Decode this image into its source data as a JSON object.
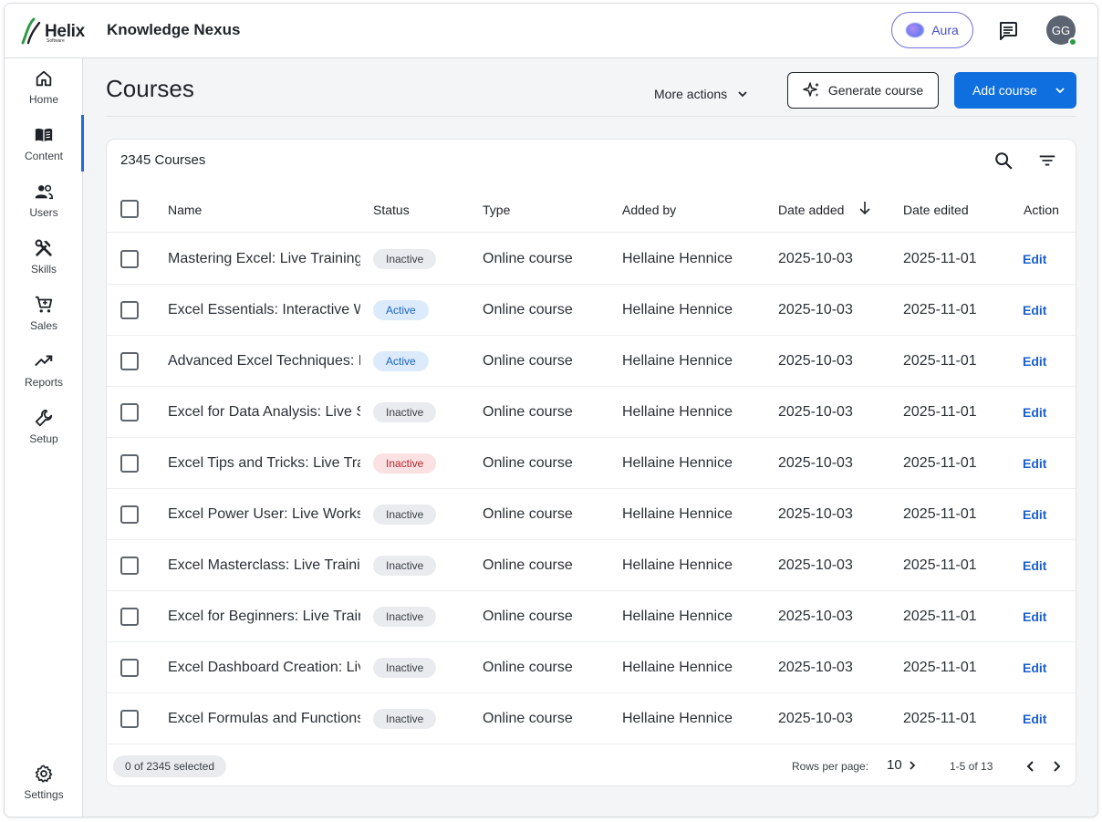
{
  "app": {
    "logo_text": "Helix",
    "logo_sub": "Software",
    "name": "Knowledge Nexus",
    "aura_label": "Aura",
    "avatar_initials": "GG"
  },
  "sidebar": {
    "items": [
      {
        "label": "Home",
        "icon": "home-icon"
      },
      {
        "label": "Content",
        "icon": "book-icon",
        "active": true
      },
      {
        "label": "Users",
        "icon": "users-icon"
      },
      {
        "label": "Skills",
        "icon": "tools-icon"
      },
      {
        "label": "Sales",
        "icon": "cart-icon"
      },
      {
        "label": "Reports",
        "icon": "trending-up-icon"
      },
      {
        "label": "Setup",
        "icon": "wrench-icon"
      }
    ],
    "settings_label": "Settings"
  },
  "page": {
    "title": "Courses",
    "more_actions": "More actions",
    "generate_course": "Generate course",
    "add_course": "Add course"
  },
  "table": {
    "count_label": "2345 Courses",
    "columns": [
      "Name",
      "Status",
      "Type",
      "Added by",
      "Date added",
      "Date edited",
      "Action"
    ],
    "rows": [
      {
        "name": "Mastering Excel: Live Training",
        "status": "Inactive",
        "status_style": "inactive",
        "type": "Online course",
        "added_by": "Hellaine Hennice",
        "date_added": "2025-10-03",
        "date_edited": "2025-11-01",
        "action": "Edit"
      },
      {
        "name": "Excel Essentials: Interactive Workshop",
        "status": "Active",
        "status_style": "active",
        "type": "Online course",
        "added_by": "Hellaine Hennice",
        "date_added": "2025-10-03",
        "date_edited": "2025-11-01",
        "action": "Edit"
      },
      {
        "name": "Advanced Excel Techniques: Live",
        "status": "Active",
        "status_style": "active",
        "type": "Online course",
        "added_by": "Hellaine Hennice",
        "date_added": "2025-10-03",
        "date_edited": "2025-11-01",
        "action": "Edit"
      },
      {
        "name": "Excel for Data Analysis: Live Session",
        "status": "Inactive",
        "status_style": "inactive",
        "type": "Online course",
        "added_by": "Hellaine Hennice",
        "date_added": "2025-10-03",
        "date_edited": "2025-11-01",
        "action": "Edit"
      },
      {
        "name": "Excel Tips and Tricks: Live Training",
        "status": "Inactive",
        "status_style": "inactive-red",
        "type": "Online course",
        "added_by": "Hellaine Hennice",
        "date_added": "2025-10-03",
        "date_edited": "2025-11-01",
        "action": "Edit"
      },
      {
        "name": "Excel Power User: Live Workshop",
        "status": "Inactive",
        "status_style": "inactive",
        "type": "Online course",
        "added_by": "Hellaine Hennice",
        "date_added": "2025-10-03",
        "date_edited": "2025-11-01",
        "action": "Edit"
      },
      {
        "name": "Excel Masterclass: Live Training",
        "status": "Inactive",
        "status_style": "inactive",
        "type": "Online course",
        "added_by": "Hellaine Hennice",
        "date_added": "2025-10-03",
        "date_edited": "2025-11-01",
        "action": "Edit"
      },
      {
        "name": "Excel for Beginners: Live Training",
        "status": "Inactive",
        "status_style": "inactive",
        "type": "Online course",
        "added_by": "Hellaine Hennice",
        "date_added": "2025-10-03",
        "date_edited": "2025-11-01",
        "action": "Edit"
      },
      {
        "name": "Excel Dashboard Creation: Live",
        "status": "Inactive",
        "status_style": "inactive",
        "type": "Online course",
        "added_by": "Hellaine Hennice",
        "date_added": "2025-10-03",
        "date_edited": "2025-11-01",
        "action": "Edit"
      },
      {
        "name": "Excel Formulas and Functions: Live",
        "status": "Inactive",
        "status_style": "inactive",
        "type": "Online course",
        "added_by": "Hellaine Hennice",
        "date_added": "2025-10-03",
        "date_edited": "2025-11-01",
        "action": "Edit"
      }
    ]
  },
  "footer": {
    "selected": "0 of 2345 selected",
    "rows_per_page_label": "Rows per page:",
    "rows_per_page_value": "10",
    "range": "1-5 of 13"
  },
  "colors": {
    "primary": "#0f6fde",
    "active_nav": "#1a6fd6",
    "aura_border": "#6d6fd6",
    "status_online": "#2e9a47"
  }
}
